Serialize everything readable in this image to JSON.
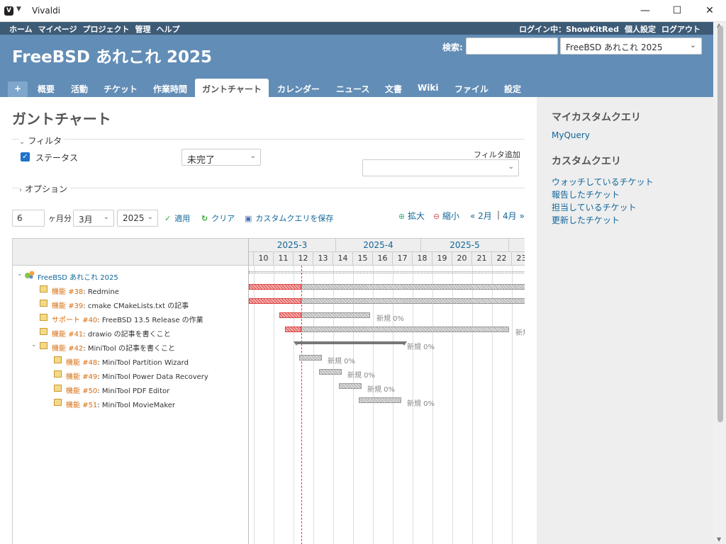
{
  "window": {
    "title": "Vivaldi",
    "minimize": "—",
    "maximize": "☐",
    "close": "✕"
  },
  "top_menu": {
    "left": [
      "ホーム",
      "マイページ",
      "プロジェクト",
      "管理",
      "ヘルプ"
    ],
    "login_label": "ログイン中：",
    "user": "ShowKitRed",
    "my_account": "個人設定",
    "logout": "ログアウト"
  },
  "header": {
    "project_title": "FreeBSD あれこれ 2025",
    "search_label": "検索:",
    "search_value": "",
    "project_select": "FreeBSD あれこれ 2025"
  },
  "tabs": {
    "plus": "+",
    "items": [
      "概要",
      "活動",
      "チケット",
      "作業時間",
      "ガントチャート",
      "カレンダー",
      "ニュース",
      "文書",
      "Wiki",
      "ファイル",
      "設定"
    ],
    "selected": "ガントチャート"
  },
  "page": {
    "title": "ガントチャート",
    "filter_legend": "フィルタ",
    "options_legend": "オプション",
    "status_label": "ステータス",
    "status_value": "未完了",
    "add_filter_label": "フィルタ追加",
    "months_value": "6",
    "months_label": "ヶ月分",
    "month_select": "3月",
    "year_select": "2025",
    "apply": "適用",
    "clear": "クリア",
    "save_query": "カスタムクエリを保存",
    "zoom_in": "拡大",
    "zoom_out": "縮小",
    "prev": "« 2月",
    "sep": "|",
    "next": "4月 »"
  },
  "gantt": {
    "months": [
      "2025-3",
      "2025-4",
      "2025-5"
    ],
    "weeks": [
      "10",
      "11",
      "12",
      "13",
      "14",
      "15",
      "16",
      "17",
      "18",
      "19",
      "20",
      "21",
      "22",
      "23"
    ],
    "project": "FreeBSD あれこれ 2025",
    "issues": [
      {
        "tracker": "機能",
        "number": "#38",
        "subject": ": Redmine",
        "label": ""
      },
      {
        "tracker": "機能",
        "number": "#39",
        "subject": ": cmake CMakeLists.txt の記事",
        "label": ""
      },
      {
        "tracker": "サポート",
        "number": "#40",
        "subject": ": FreeBSD 13.5 Release の作業",
        "label": "新規 0%"
      },
      {
        "tracker": "機能",
        "number": "#41",
        "subject": ": drawio の記事を書くこと",
        "label": "新規"
      },
      {
        "tracker": "機能",
        "number": "#42",
        "subject": ": MiniTool の記事を書くこと",
        "label": "新規 0%"
      },
      {
        "tracker": "機能",
        "number": "#48",
        "subject": ": MiniTool Partition Wizard",
        "label": "新規 0%"
      },
      {
        "tracker": "機能",
        "number": "#49",
        "subject": ": MiniTool Power Data Recovery",
        "label": "新規 0%"
      },
      {
        "tracker": "機能",
        "number": "#50",
        "subject": ": MiniTool PDF Editor",
        "label": "新規 0%"
      },
      {
        "tracker": "機能",
        "number": "#51",
        "subject": ": MiniTool MovieMaker",
        "label": "新規 0%"
      }
    ]
  },
  "sidebar": {
    "my_queries_title": "マイカスタムクエリ",
    "my_queries": [
      "MyQuery"
    ],
    "queries_title": "カスタムクエリ",
    "queries": [
      "ウォッチしているチケット",
      "報告したチケット",
      "担当しているチケット",
      "更新したチケット"
    ]
  },
  "colors": {
    "header": "#628db6",
    "top_menu": "#3e5b76",
    "link": "#116699",
    "tracker_feature": "#d96c0c",
    "late_bar": "#e05050",
    "today_line": "#ee3333"
  }
}
